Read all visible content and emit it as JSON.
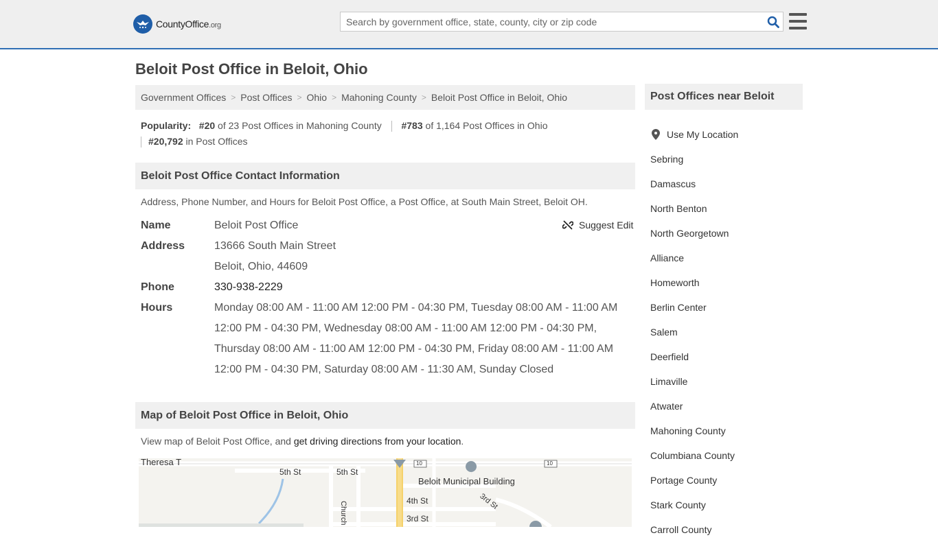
{
  "header": {
    "logo_text_main": "CountyOffice",
    "logo_text_tld": ".org",
    "search_placeholder": "Search by government office, state, county, city or zip code"
  },
  "page": {
    "title": "Beloit Post Office in Beloit, Ohio"
  },
  "breadcrumb": [
    "Government Offices",
    "Post Offices",
    "Ohio",
    "Mahoning County",
    "Beloit Post Office in Beloit, Ohio"
  ],
  "popularity": {
    "label": "Popularity:",
    "county_rank": "#20",
    "county_text": "of 23 Post Offices in Mahoning County",
    "state_rank": "#783",
    "state_text": "of 1,164 Post Offices in Ohio",
    "national_rank": "#20,792",
    "national_text": "in Post Offices"
  },
  "contact": {
    "heading": "Beloit Post Office Contact Information",
    "description": "Address, Phone Number, and Hours for Beloit Post Office, a Post Office, at South Main Street, Beloit OH.",
    "suggest_edit": "Suggest Edit",
    "name_label": "Name",
    "name": "Beloit Post Office",
    "address_label": "Address",
    "address_line1": "13666 South Main Street",
    "address_line2": "Beloit, Ohio, 44609",
    "phone_label": "Phone",
    "phone": "330-938-2229",
    "hours_label": "Hours",
    "hours": "Monday 08:00 AM - 11:00 AM 12:00 PM - 04:30 PM, Tuesday 08:00 AM - 11:00 AM 12:00 PM - 04:30 PM, Wednesday 08:00 AM - 11:00 AM 12:00 PM - 04:30 PM, Thursday 08:00 AM - 11:00 AM 12:00 PM - 04:30 PM, Friday 08:00 AM - 11:00 AM 12:00 PM - 04:30 PM, Saturday 08:00 AM - 11:30 AM, Sunday Closed"
  },
  "map": {
    "heading": "Map of Beloit Post Office in Beloit, Ohio",
    "desc_prefix": "View map of Beloit Post Office, and ",
    "desc_link": "get driving directions from your location",
    "desc_suffix": ".",
    "labels": {
      "theresa": "Theresa T",
      "fifth_st_a": "5th St",
      "fifth_st_b": "5th St",
      "church_ave": "Church Ave",
      "municipal": "Beloit Municipal Building",
      "fourth_st": "4th St",
      "third_st_a": "3rd St",
      "third_st_b": "3rd St",
      "route_a": "10",
      "route_b": "10"
    }
  },
  "sidebar": {
    "heading": "Post Offices near Beloit",
    "use_location": "Use My Location",
    "items": [
      "Sebring",
      "Damascus",
      "North Benton",
      "North Georgetown",
      "Alliance",
      "Homeworth",
      "Berlin Center",
      "Salem",
      "Deerfield",
      "Limaville",
      "Atwater",
      "Mahoning County",
      "Columbiana County",
      "Portage County",
      "Stark County",
      "Carroll County"
    ]
  },
  "colors": {
    "brand_blue": "#1f5ea8",
    "header_bg": "#efefef",
    "section_bg": "#f0f0f0",
    "header_border": "#2f6eb4"
  }
}
